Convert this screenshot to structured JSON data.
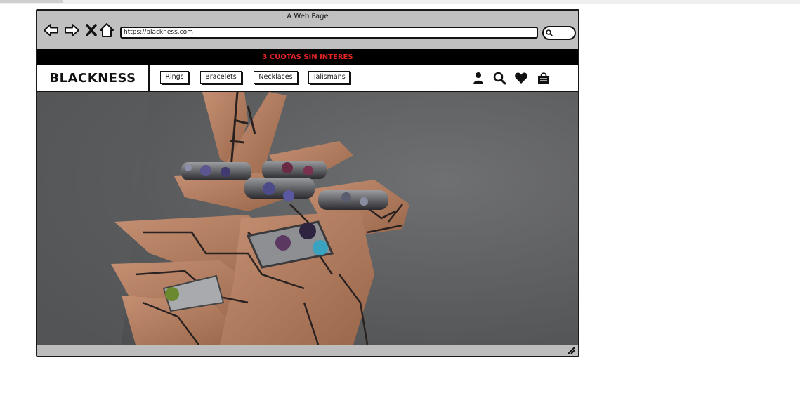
{
  "window": {
    "title": "A Web Page",
    "url": "https://blackness.com"
  },
  "promo": {
    "text": "3 CUOTAS SIN INTERES",
    "color": "#e02424"
  },
  "brand": {
    "name": "BLACKNESS"
  },
  "menu": [
    {
      "label": "Rings"
    },
    {
      "label": "Bracelets"
    },
    {
      "label": "Necklaces"
    },
    {
      "label": "Talismans"
    }
  ],
  "header_icons": [
    "user-icon",
    "search-icon",
    "heart-icon",
    "shopping-bag-icon"
  ],
  "nav_icons": [
    "back-arrow-icon",
    "forward-arrow-icon",
    "close-icon",
    "home-icon"
  ]
}
